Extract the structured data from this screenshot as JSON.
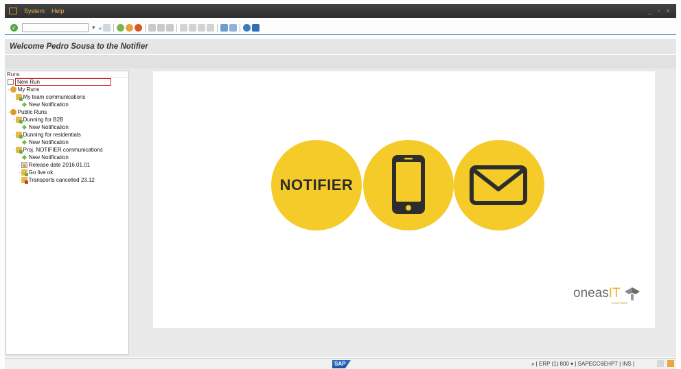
{
  "menu": {
    "items": [
      "System",
      "Help"
    ],
    "window_controls": "_ ▫ ×"
  },
  "toolbar": {
    "command_field_value": "",
    "nav_back_label": "«"
  },
  "title": "Welcome Pedro Sousa to the Notifier",
  "tree": {
    "header": "Runs",
    "nodes": [
      "New Run",
      "My Runs",
      "My team communications",
      "New Notification",
      "Public Runs",
      "Dunning for B2B",
      "New Notification",
      "Dunning for residentials",
      "New Notification",
      "Proj. NOTIFIER communications",
      "New Notification",
      "Release date 2016.01.01",
      "Go live ok",
      "Transports cancelled 23.12"
    ]
  },
  "banner": {
    "notifier_label": "NOTIFIER",
    "logo_text_gray": "oneas",
    "logo_text_gold": "IT",
    "logo_sub": "SOLUTIONS"
  },
  "status": {
    "sap_label": "SAP",
    "info": "» | ERP (1) 800 ▾ | SAPECC6EHP7 | INS |"
  },
  "colors": {
    "accent_yellow": "#f5cb2a",
    "menu_gold": "#e8b04a",
    "toolbar_rule": "#4b8fc8"
  }
}
